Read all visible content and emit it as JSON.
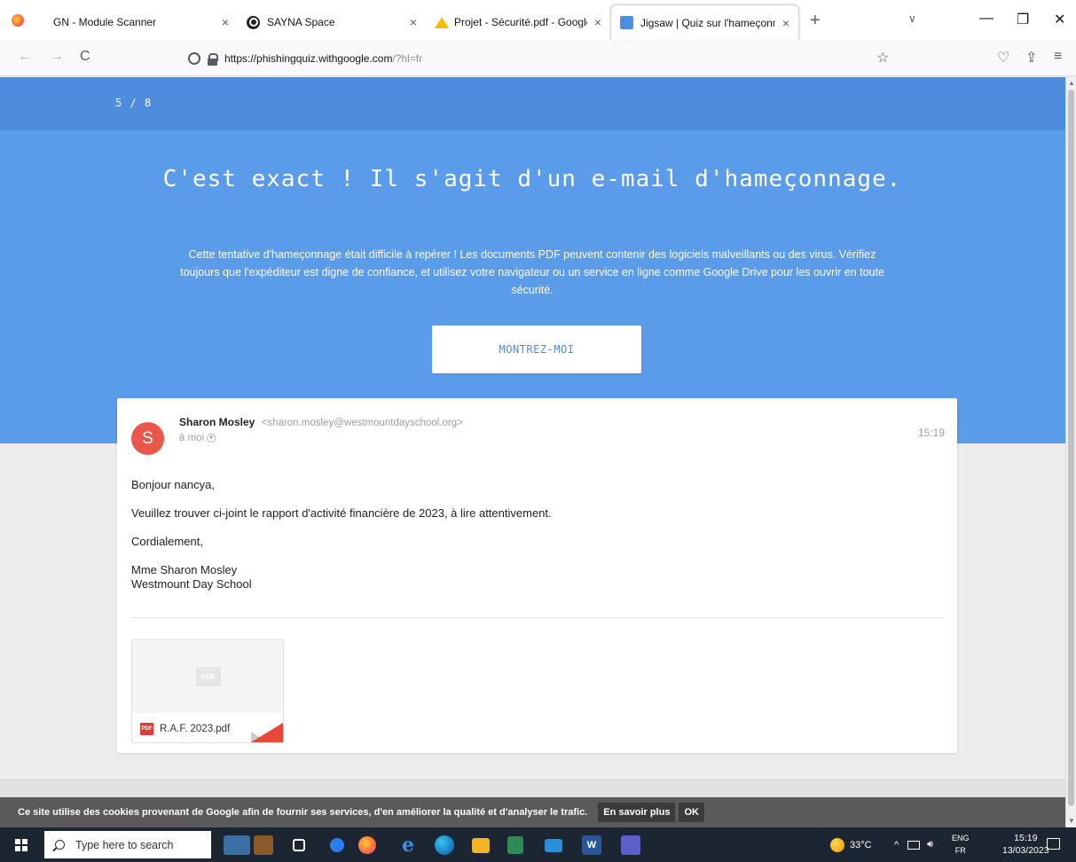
{
  "browser": {
    "tabs": [
      {
        "title": "GN - Module Scanner",
        "close": "×"
      },
      {
        "title": "SAYNA Space",
        "close": "×"
      },
      {
        "title": "Projet - Sécurité.pdf - Google D",
        "close": "×"
      },
      {
        "title": "Jigsaw | Quiz sur l'hameçonnage",
        "close": "×"
      }
    ],
    "new_tab": "+",
    "tabs_menu": "∨",
    "window_controls": {
      "minimize": "—",
      "restore": "❐",
      "close": "✕"
    },
    "nav": {
      "back": "←",
      "forward": "→",
      "reload": "C"
    },
    "url_host": "https://phishingquiz.withgoogle.com",
    "url_rest": "/?hl=fr",
    "toolbar_icons": {
      "bookmark": "☆",
      "pocket": "♡",
      "extensions": "⇪",
      "menu": "≡"
    }
  },
  "quiz": {
    "progress": "5 / 8",
    "title": "C'est exact ! Il s'agit d'un e-mail d'hameçonnage.",
    "explanation": "Cette tentative d'hameçonnage était difficile à repérer ! Les documents PDF peuvent contenir des logiciels malveillants ou des virus. Vérifiez toujours que l'expéditeur est digne de confiance, et utilisez votre navigateur ou un service en ligne comme Google Drive pour les ouvrir en toute sécurité.",
    "show_button": "MONTREZ-MOI"
  },
  "email": {
    "avatar_letter": "S",
    "sender_name": "Sharon Mosley",
    "sender_email": "<sharon.mosley@westmountdayschool.org>",
    "recipient": "à moi",
    "time": "15:19",
    "greeting": "Bonjour nancya,",
    "body": "Veuillez trouver ci-joint le rapport d'activité financière de 2023, à lire attentivement.",
    "closing": "Cordialement,",
    "signature_name": "Mme Sharon Mosley",
    "signature_org": "Westmount Day School",
    "attachment": {
      "preview_label": "PDF",
      "type_label": "PDF",
      "name": "R.A.F. 2023.pdf"
    }
  },
  "cookie_bar": {
    "text": "Ce site utilise des cookies provenant de Google afin de fournir ses services, d'en améliorer la qualité et d'analyser le trafic.",
    "learn_more": "En savoir plus",
    "ok": "OK"
  },
  "taskbar": {
    "search_placeholder": "Type here to search",
    "temperature": "33°C",
    "lang_top": "ENG",
    "lang_bottom": "FR",
    "time": "15:19",
    "date": "13/03/2023",
    "tray_arrow": "^",
    "word_label": "W",
    "edge_label": "e"
  }
}
